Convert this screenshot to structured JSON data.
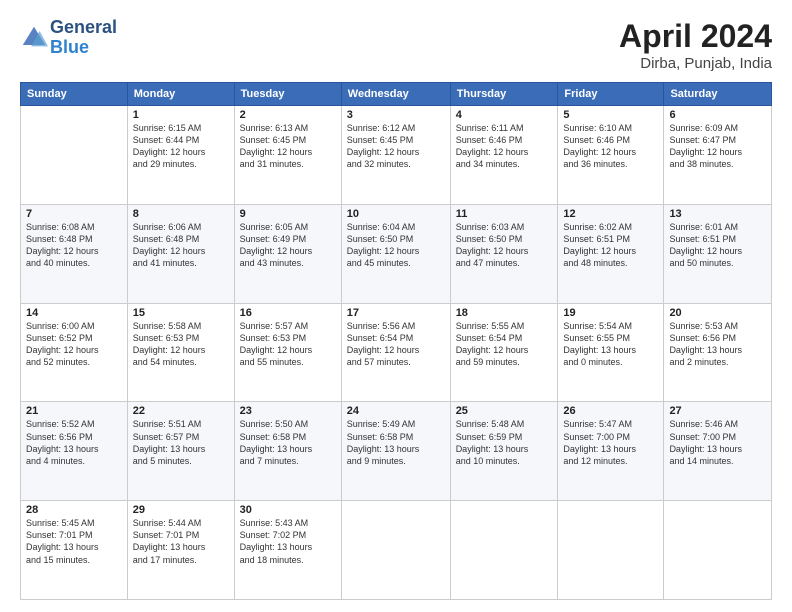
{
  "logo": {
    "line1": "General",
    "line2": "Blue"
  },
  "title": "April 2024",
  "location": "Dirba, Punjab, India",
  "days_of_week": [
    "Sunday",
    "Monday",
    "Tuesday",
    "Wednesday",
    "Thursday",
    "Friday",
    "Saturday"
  ],
  "weeks": [
    [
      {
        "day": "",
        "info": ""
      },
      {
        "day": "1",
        "info": "Sunrise: 6:15 AM\nSunset: 6:44 PM\nDaylight: 12 hours\nand 29 minutes."
      },
      {
        "day": "2",
        "info": "Sunrise: 6:13 AM\nSunset: 6:45 PM\nDaylight: 12 hours\nand 31 minutes."
      },
      {
        "day": "3",
        "info": "Sunrise: 6:12 AM\nSunset: 6:45 PM\nDaylight: 12 hours\nand 32 minutes."
      },
      {
        "day": "4",
        "info": "Sunrise: 6:11 AM\nSunset: 6:46 PM\nDaylight: 12 hours\nand 34 minutes."
      },
      {
        "day": "5",
        "info": "Sunrise: 6:10 AM\nSunset: 6:46 PM\nDaylight: 12 hours\nand 36 minutes."
      },
      {
        "day": "6",
        "info": "Sunrise: 6:09 AM\nSunset: 6:47 PM\nDaylight: 12 hours\nand 38 minutes."
      }
    ],
    [
      {
        "day": "7",
        "info": "Sunrise: 6:08 AM\nSunset: 6:48 PM\nDaylight: 12 hours\nand 40 minutes."
      },
      {
        "day": "8",
        "info": "Sunrise: 6:06 AM\nSunset: 6:48 PM\nDaylight: 12 hours\nand 41 minutes."
      },
      {
        "day": "9",
        "info": "Sunrise: 6:05 AM\nSunset: 6:49 PM\nDaylight: 12 hours\nand 43 minutes."
      },
      {
        "day": "10",
        "info": "Sunrise: 6:04 AM\nSunset: 6:50 PM\nDaylight: 12 hours\nand 45 minutes."
      },
      {
        "day": "11",
        "info": "Sunrise: 6:03 AM\nSunset: 6:50 PM\nDaylight: 12 hours\nand 47 minutes."
      },
      {
        "day": "12",
        "info": "Sunrise: 6:02 AM\nSunset: 6:51 PM\nDaylight: 12 hours\nand 48 minutes."
      },
      {
        "day": "13",
        "info": "Sunrise: 6:01 AM\nSunset: 6:51 PM\nDaylight: 12 hours\nand 50 minutes."
      }
    ],
    [
      {
        "day": "14",
        "info": "Sunrise: 6:00 AM\nSunset: 6:52 PM\nDaylight: 12 hours\nand 52 minutes."
      },
      {
        "day": "15",
        "info": "Sunrise: 5:58 AM\nSunset: 6:53 PM\nDaylight: 12 hours\nand 54 minutes."
      },
      {
        "day": "16",
        "info": "Sunrise: 5:57 AM\nSunset: 6:53 PM\nDaylight: 12 hours\nand 55 minutes."
      },
      {
        "day": "17",
        "info": "Sunrise: 5:56 AM\nSunset: 6:54 PM\nDaylight: 12 hours\nand 57 minutes."
      },
      {
        "day": "18",
        "info": "Sunrise: 5:55 AM\nSunset: 6:54 PM\nDaylight: 12 hours\nand 59 minutes."
      },
      {
        "day": "19",
        "info": "Sunrise: 5:54 AM\nSunset: 6:55 PM\nDaylight: 13 hours\nand 0 minutes."
      },
      {
        "day": "20",
        "info": "Sunrise: 5:53 AM\nSunset: 6:56 PM\nDaylight: 13 hours\nand 2 minutes."
      }
    ],
    [
      {
        "day": "21",
        "info": "Sunrise: 5:52 AM\nSunset: 6:56 PM\nDaylight: 13 hours\nand 4 minutes."
      },
      {
        "day": "22",
        "info": "Sunrise: 5:51 AM\nSunset: 6:57 PM\nDaylight: 13 hours\nand 5 minutes."
      },
      {
        "day": "23",
        "info": "Sunrise: 5:50 AM\nSunset: 6:58 PM\nDaylight: 13 hours\nand 7 minutes."
      },
      {
        "day": "24",
        "info": "Sunrise: 5:49 AM\nSunset: 6:58 PM\nDaylight: 13 hours\nand 9 minutes."
      },
      {
        "day": "25",
        "info": "Sunrise: 5:48 AM\nSunset: 6:59 PM\nDaylight: 13 hours\nand 10 minutes."
      },
      {
        "day": "26",
        "info": "Sunrise: 5:47 AM\nSunset: 7:00 PM\nDaylight: 13 hours\nand 12 minutes."
      },
      {
        "day": "27",
        "info": "Sunrise: 5:46 AM\nSunset: 7:00 PM\nDaylight: 13 hours\nand 14 minutes."
      }
    ],
    [
      {
        "day": "28",
        "info": "Sunrise: 5:45 AM\nSunset: 7:01 PM\nDaylight: 13 hours\nand 15 minutes."
      },
      {
        "day": "29",
        "info": "Sunrise: 5:44 AM\nSunset: 7:01 PM\nDaylight: 13 hours\nand 17 minutes."
      },
      {
        "day": "30",
        "info": "Sunrise: 5:43 AM\nSunset: 7:02 PM\nDaylight: 13 hours\nand 18 minutes."
      },
      {
        "day": "",
        "info": ""
      },
      {
        "day": "",
        "info": ""
      },
      {
        "day": "",
        "info": ""
      },
      {
        "day": "",
        "info": ""
      }
    ]
  ]
}
